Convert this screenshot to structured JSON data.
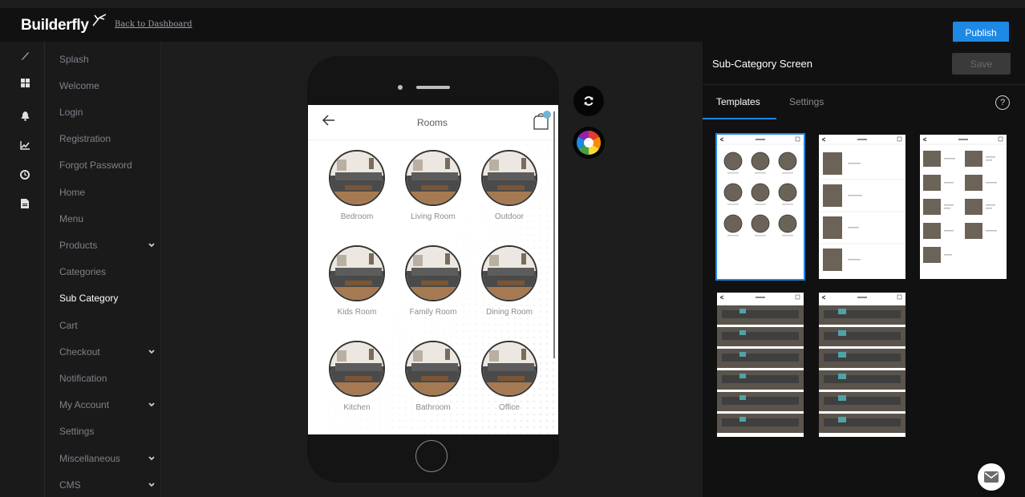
{
  "app": {
    "logo": "Builderfly",
    "back_link": "Back to Dashboard",
    "publish": "Publish"
  },
  "icon_bar": [
    "brush-icon",
    "grid-icon",
    "bell-icon",
    "chart-icon",
    "clock-icon",
    "document-icon"
  ],
  "nav": {
    "items": [
      {
        "label": "Splash"
      },
      {
        "label": "Welcome"
      },
      {
        "label": "Login"
      },
      {
        "label": "Registration"
      },
      {
        "label": "Forgot Password"
      },
      {
        "label": "Home"
      },
      {
        "label": "Menu"
      },
      {
        "label": "Products",
        "has_children": true
      },
      {
        "label": "Categories"
      },
      {
        "label": "Sub Category",
        "active": true
      },
      {
        "label": "Cart"
      },
      {
        "label": "Checkout",
        "has_children": true
      },
      {
        "label": "Notification"
      },
      {
        "label": "My Account",
        "has_children": true
      },
      {
        "label": "Settings"
      },
      {
        "label": "Miscellaneous",
        "has_children": true
      },
      {
        "label": "CMS",
        "has_children": true
      }
    ]
  },
  "preview": {
    "title": "Rooms",
    "categories": [
      "Bedroom",
      "Living Room",
      "Outdoor",
      "Kids Room",
      "Family Room",
      "Dining Room",
      "Kitchen",
      "Bathroom",
      "Office"
    ]
  },
  "panel": {
    "title": "Sub-Category Screen",
    "save": "Save",
    "tabs": [
      "Templates",
      "Settings"
    ],
    "help": "?"
  },
  "colors": {
    "accent": "#1e88e5",
    "background": "#1d1d1d",
    "panel": "#111111"
  }
}
